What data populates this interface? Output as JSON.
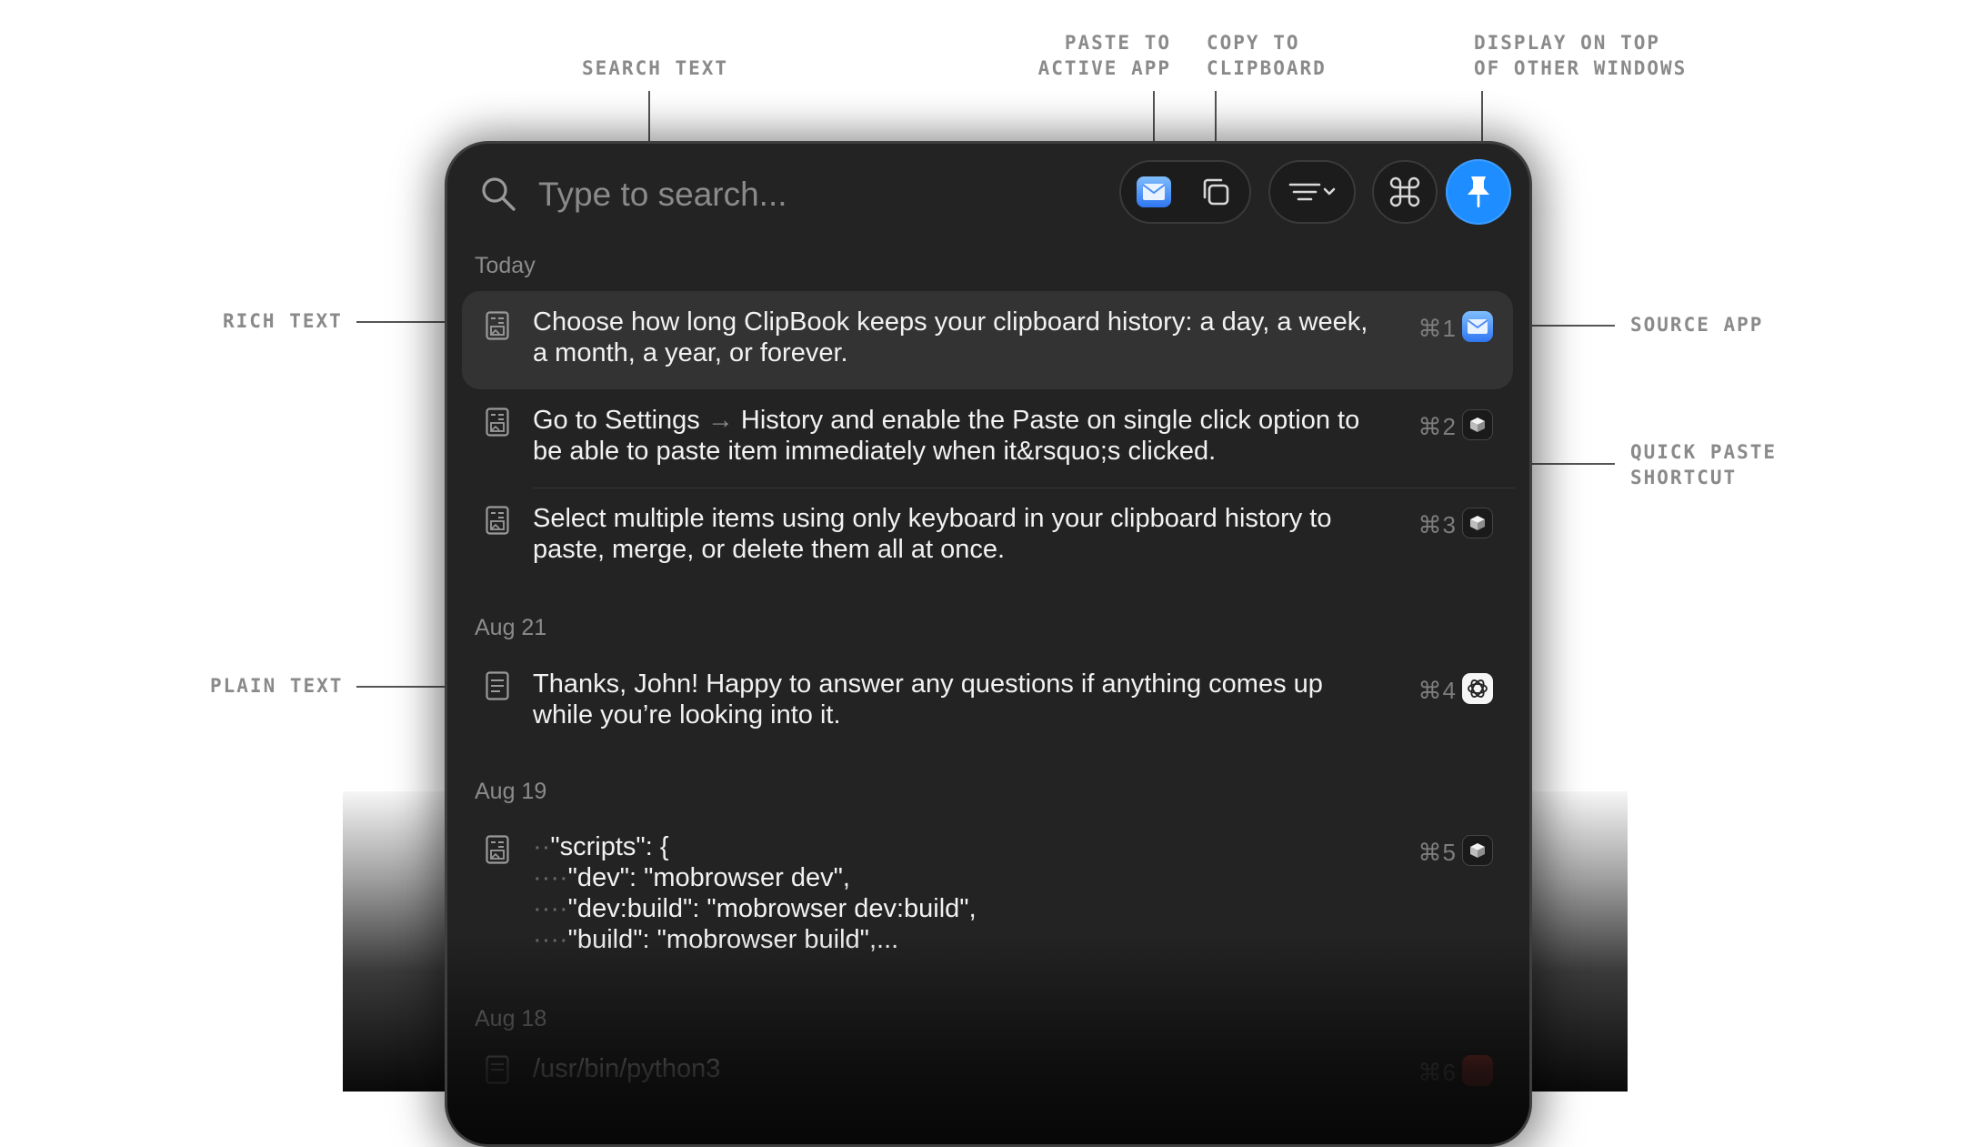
{
  "annotations": {
    "search_text": "SEARCH TEXT",
    "paste_to_active_app": [
      "PASTE TO",
      "ACTIVE APP"
    ],
    "copy_to_clipboard": [
      "COPY TO",
      "CLIPBOARD"
    ],
    "display_on_top": [
      "DISPLAY ON TOP",
      "OF OTHER WINDOWS"
    ],
    "rich_text": "RICH TEXT",
    "source_app": "SOURCE APP",
    "quick_paste_shortcut": [
      "QUICK PASTE",
      "SHORTCUT"
    ],
    "plain_text": "PLAIN TEXT"
  },
  "search": {
    "placeholder": "Type to search..."
  },
  "toolbar": {
    "paste_icon": "mail-app-icon",
    "copy_icon": "copy-icon",
    "filter_icon": "filter-icon",
    "command_icon": "command-icon",
    "pin_icon": "pin-icon",
    "pin_color": "#1e8dff"
  },
  "sections": [
    {
      "label": "Today"
    },
    {
      "label": "Aug 21"
    },
    {
      "label": "Aug 19"
    },
    {
      "label": "Aug 18"
    }
  ],
  "items": [
    {
      "type": "rich-text",
      "lines": [
        "Choose how long ClipBook keeps your clipboard history: a day, a week,",
        "a month, a year, or forever."
      ],
      "shortcut": "⌘1",
      "source_app": "mail",
      "selected": true
    },
    {
      "type": "rich-text",
      "line1_a": "Go to Settings",
      "arrow": "→",
      "line1_b": "History and enable the Paste on single click option to",
      "line2": "be able to paste item immediately when it&rsquo;s clicked.",
      "shortcut": "⌘2",
      "source_app": "cube"
    },
    {
      "type": "rich-text",
      "lines": [
        "Select multiple items using only keyboard in your clipboard history to",
        "paste, merge, or delete them all at once."
      ],
      "shortcut": "⌘3",
      "source_app": "cube"
    },
    {
      "type": "plain-text",
      "lines": [
        "Thanks, John! Happy to answer any questions if anything comes up",
        "while you’re looking into it."
      ],
      "shortcut": "⌘4",
      "source_app": "openai"
    },
    {
      "type": "rich-text",
      "code_lines": [
        {
          "indent": "··",
          "text": "\"scripts\": {"
        },
        {
          "indent": "····",
          "text": "\"dev\": \"mobrowser dev\","
        },
        {
          "indent": "····",
          "text": "\"dev:build\": \"mobrowser dev:build\","
        },
        {
          "indent": "····",
          "text": "\"build\": \"mobrowser build\",..."
        }
      ],
      "shortcut": "⌘5",
      "source_app": "cube"
    },
    {
      "type": "plain-text",
      "lines": [
        "/usr/bin/python3"
      ],
      "shortcut": "⌘6",
      "source_app": "red"
    }
  ]
}
